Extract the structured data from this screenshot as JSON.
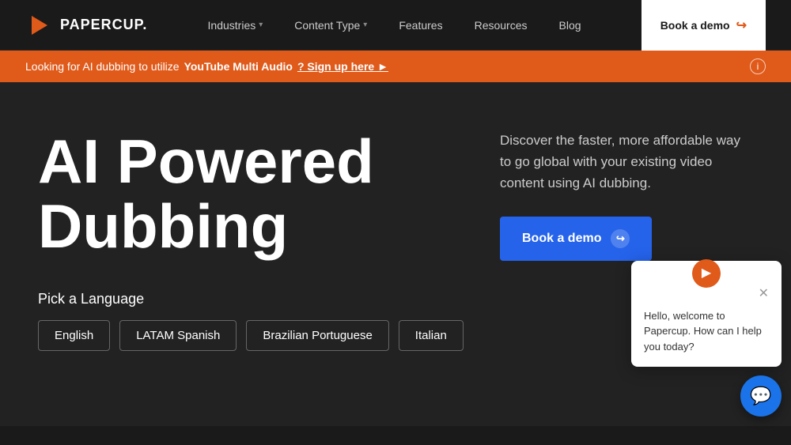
{
  "nav": {
    "logo_text": "PAPERCUP.",
    "links": [
      {
        "label": "Industries",
        "has_chevron": true
      },
      {
        "label": "Content Type",
        "has_chevron": true
      },
      {
        "label": "Features",
        "has_chevron": false
      },
      {
        "label": "Resources",
        "has_chevron": false
      },
      {
        "label": "Blog",
        "has_chevron": false
      }
    ],
    "book_demo_label": "Book a demo"
  },
  "banner": {
    "prefix_text": "Looking for AI dubbing to utilize",
    "highlight": "YouTube Multi Audio",
    "suffix": "? Sign up here ►"
  },
  "hero": {
    "title_line1": "AI Powered",
    "title_line2": "Dubbing",
    "description": "Discover the faster, more affordable way to go global with your existing video content using AI dubbing.",
    "book_demo_label": "Book a demo",
    "pick_language_label": "Pick a Language",
    "languages": [
      {
        "label": "English"
      },
      {
        "label": "LATAM Spanish"
      },
      {
        "label": "Brazilian Portuguese"
      },
      {
        "label": "Italian"
      }
    ]
  },
  "chat": {
    "greeting": "Hello, welcome to Papercup. How can I help you today?"
  }
}
